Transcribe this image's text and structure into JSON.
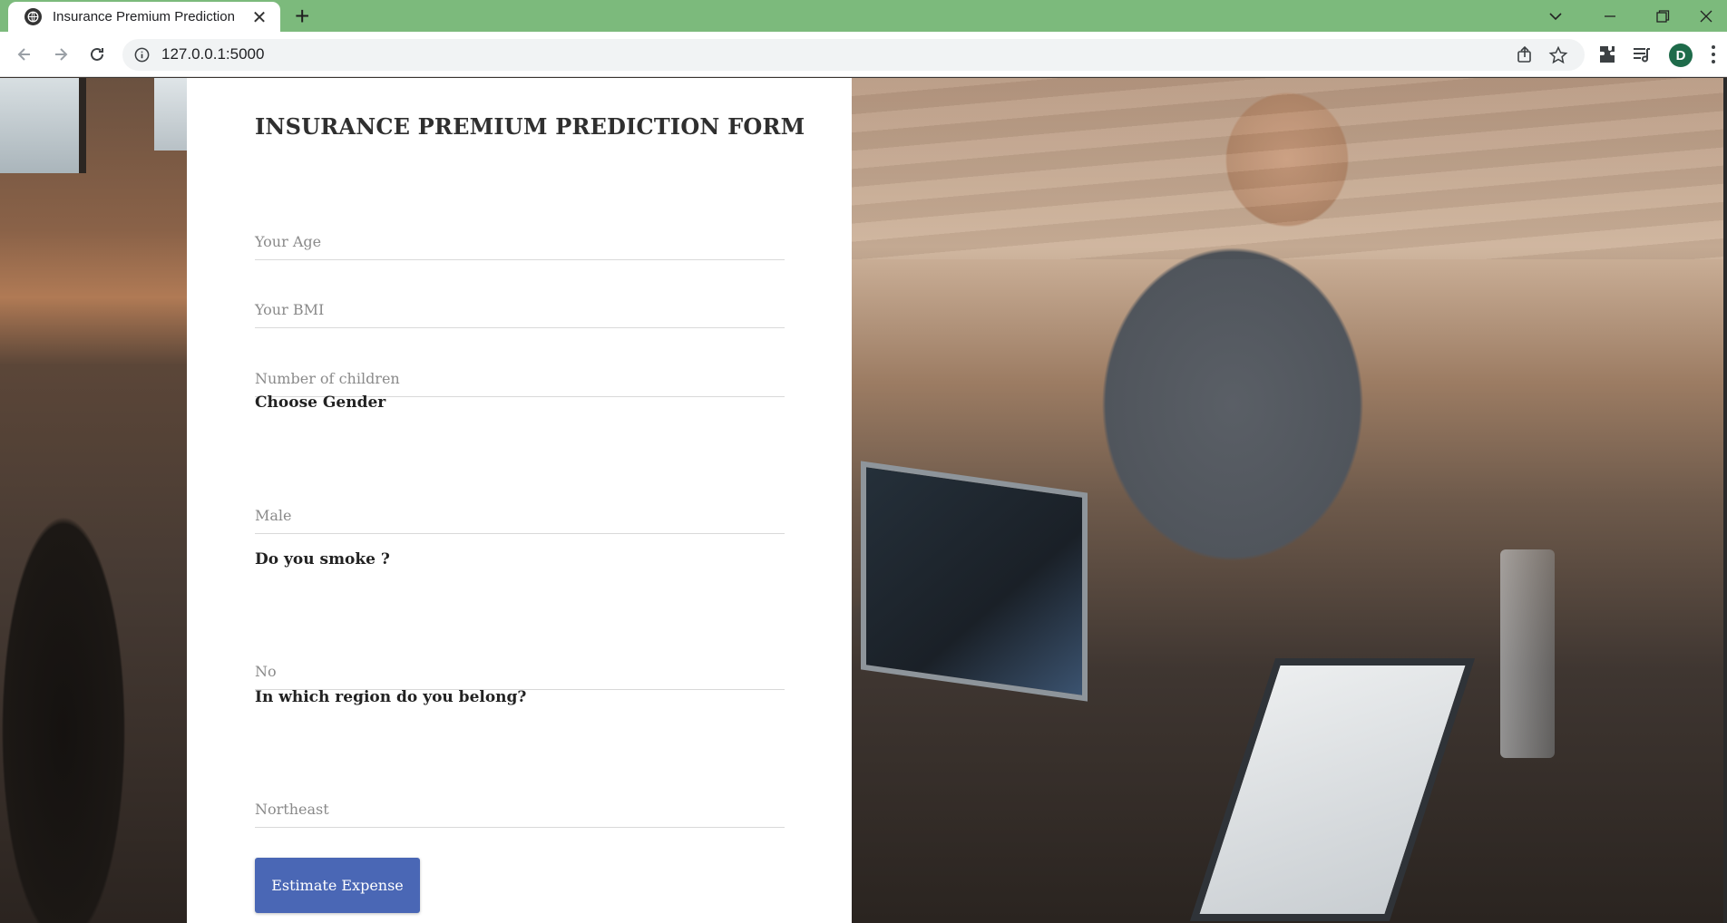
{
  "browser": {
    "tab_title": "Insurance Premium Prediction",
    "tab_close": "✕",
    "new_tab": "+",
    "url": "127.0.0.1:5000",
    "profile_initial": "D",
    "accent_color": "#7cba7c",
    "icons": [
      "globe-icon",
      "back-icon",
      "forward-icon",
      "reload-icon",
      "info-icon",
      "share-icon",
      "star-icon",
      "extensions-icon",
      "reading-list-icon",
      "menu-icon",
      "chevron-down-icon",
      "minimize-icon",
      "restore-icon",
      "close-icon"
    ]
  },
  "form": {
    "title": "INSURANCE PREMIUM PREDICTION FORM",
    "age_placeholder": "Your Age",
    "bmi_placeholder": "Your BMI",
    "children_placeholder": "Number of children",
    "gender_label": "Choose Gender",
    "gender_value": "Male",
    "smoke_label": "Do you smoke ?",
    "smoke_value": "No",
    "region_label": "In which region do you belong?",
    "region_value": "Northeast",
    "submit_label": "Estimate Expense",
    "button_color": "#4a67b5"
  }
}
